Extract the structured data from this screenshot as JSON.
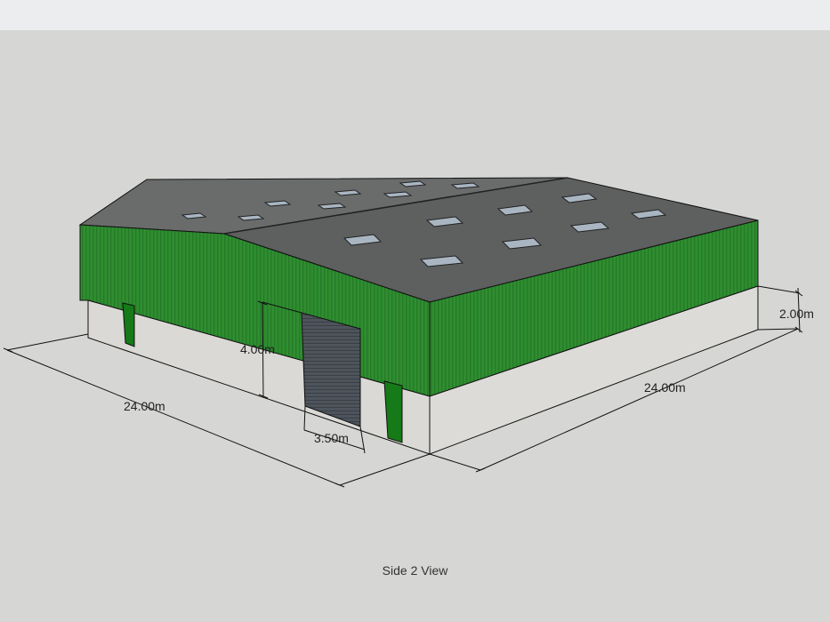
{
  "view_label": "Side 2 View",
  "dimensions": {
    "left_length": "24.00m",
    "right_length": "24.00m",
    "plinth_height": "2.00m",
    "door_height": "4.00m",
    "door_width": "3.50m"
  },
  "colors": {
    "background": "#d6d6d4",
    "cladding_green": "#2f8f2f",
    "roof_grey": "#5f6060",
    "plinth_concrete": "#dadad6",
    "door_grey": "#4a5058",
    "personnel_door_green": "#1a7a1a"
  }
}
